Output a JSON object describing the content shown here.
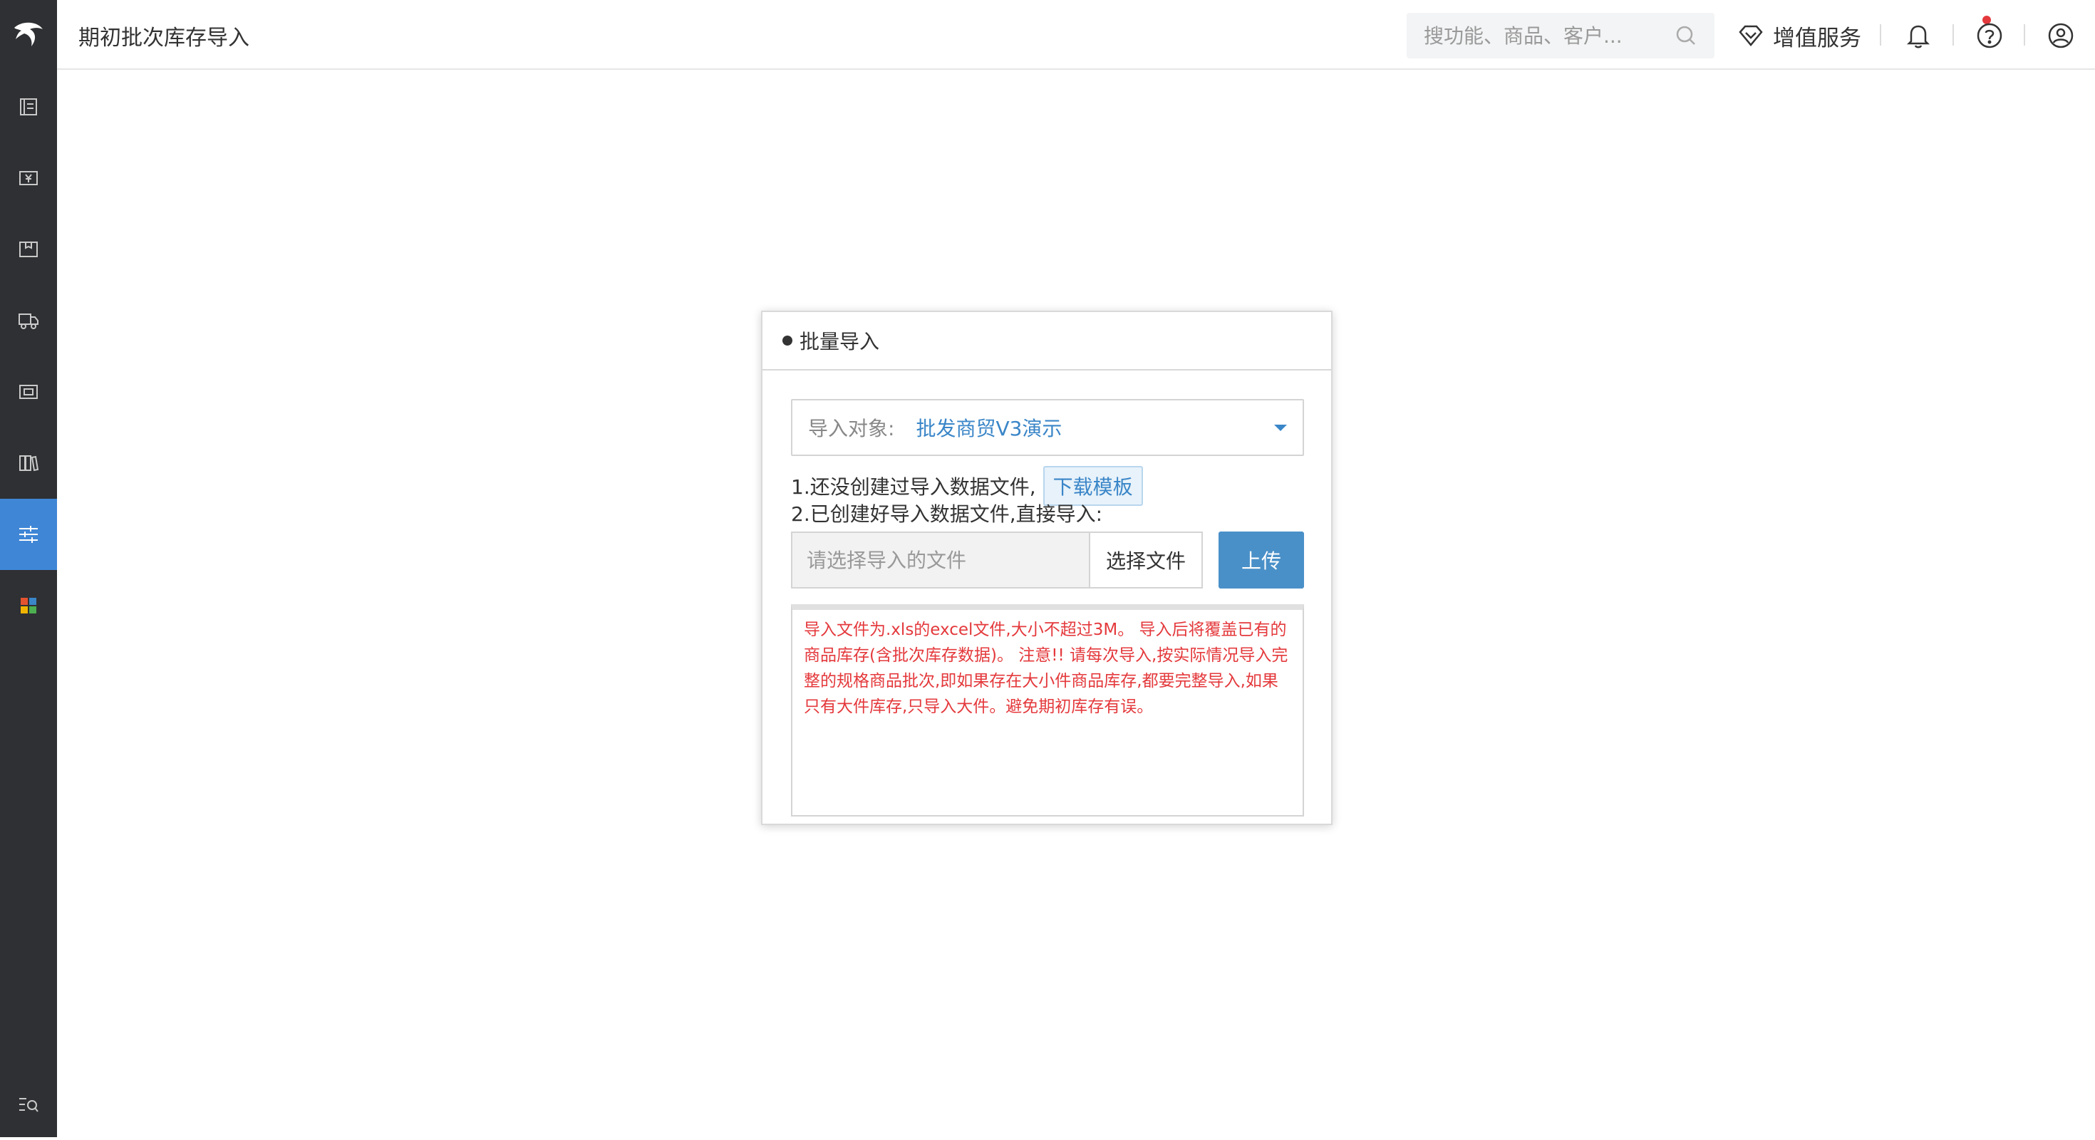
{
  "header": {
    "title": "期初批次库存导入",
    "search_placeholder": "搜功能、商品、客户...",
    "value_added_label": "增值服务"
  },
  "sidebar": {
    "items": [
      {
        "icon": "ledger-icon"
      },
      {
        "icon": "cash-icon"
      },
      {
        "icon": "package-icon"
      },
      {
        "icon": "truck-icon"
      },
      {
        "icon": "invoice-icon"
      },
      {
        "icon": "books-icon"
      },
      {
        "icon": "sliders-icon",
        "active": true
      },
      {
        "icon": "apps-grid-icon"
      }
    ],
    "bottom_icon": "search-menu-icon"
  },
  "dialog": {
    "title": "批量导入",
    "target_label": "导入对象:",
    "target_value": "批发商贸V3演示",
    "step1_text": "1.还没创建过导入数据文件,",
    "download_template": "下载模板",
    "step2_text": "2.已创建好导入数据文件,直接导入:",
    "file_placeholder": "请选择导入的文件",
    "choose_file": "选择文件",
    "upload": "上传",
    "notice": "导入文件为.xls的excel文件,大小不超过3M。 导入后将覆盖已有的商品库存(含批次库存数据)。 注意!! 请每次导入,按实际情况导入完整的规格商品批次,即如果存在大小件商品库存,都要完整导入,如果只有大件库存,只导入大件。避免期初库存有误。"
  },
  "colors": {
    "sidebar_bg": "#2f3033",
    "sidebar_active": "#3f86d6",
    "accent": "#3a86c8",
    "upload_btn": "#4a90c8",
    "notice_text": "#e4393c"
  }
}
